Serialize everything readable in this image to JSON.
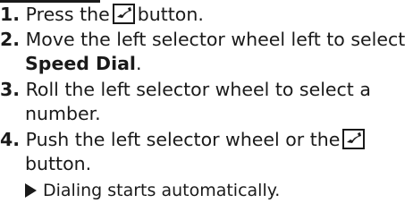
{
  "steps": [
    {
      "number": "1.",
      "before": "Press the",
      "after": "button.",
      "icon": "phone-button-icon"
    },
    {
      "number": "2.",
      "line1": "Move the left selector wheel left to select",
      "line2_bold": "Speed Dial",
      "line2_tail": "."
    },
    {
      "number": "3.",
      "line1": "Roll the left selector wheel to select a",
      "line2": "number."
    },
    {
      "number": "4.",
      "line1": "Push the left selector wheel or the",
      "line2": "button.",
      "icon": "phone-button-icon"
    }
  ],
  "result": {
    "icon": "triangle-right-icon",
    "text": "Dialing starts automatically."
  }
}
